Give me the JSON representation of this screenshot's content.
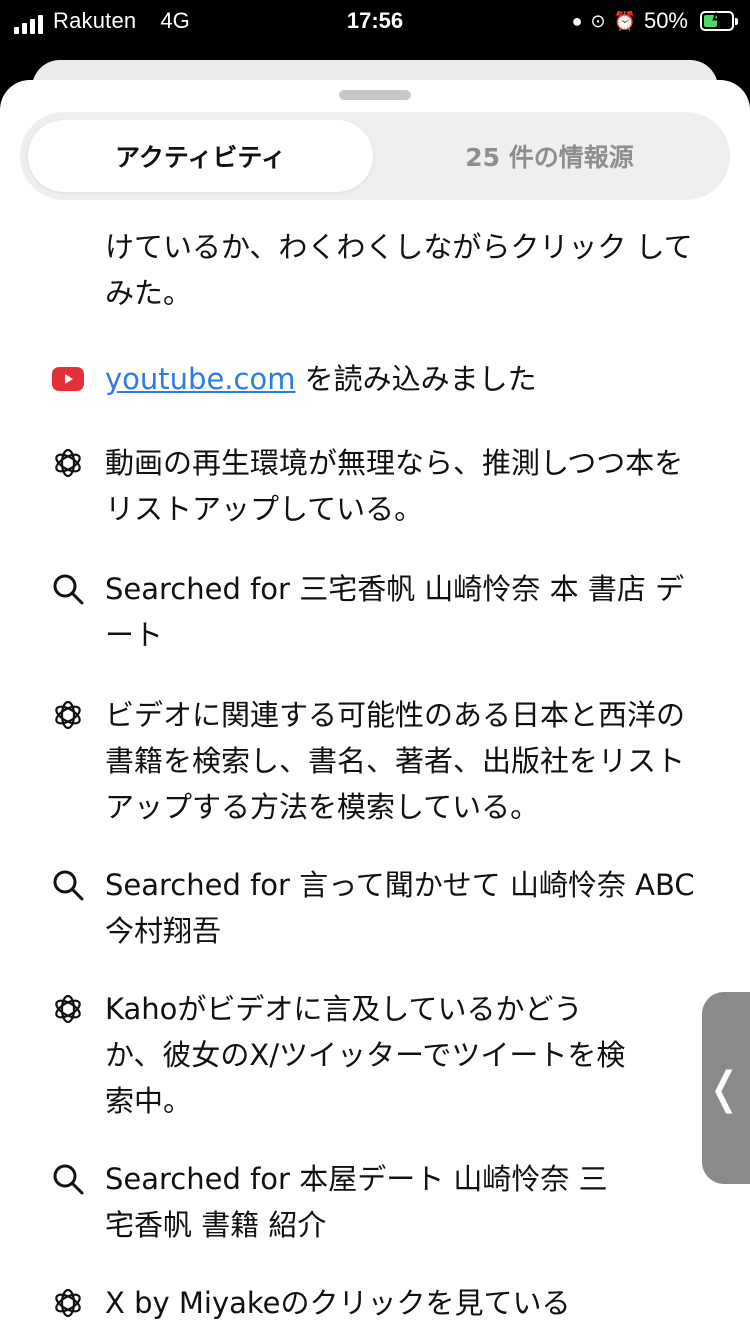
{
  "status": {
    "carrier": "Rakuten",
    "network": "4G",
    "time": "17:56",
    "battery": "50%",
    "battery_level": 0.5
  },
  "tabs": {
    "activity": "アクティビティ",
    "sources": "25 件の情報源"
  },
  "feed": [
    {
      "type": "text",
      "icon": "none",
      "text": "けているか、わくわくしながらクリック してみた。"
    },
    {
      "type": "load",
      "icon": "youtube-icon",
      "link": "youtube.com",
      "text": " を読み込みました"
    },
    {
      "type": "thought",
      "icon": "openai-icon",
      "text": "動画の再生環境が無理なら、推測しつつ本をリストアップしている。"
    },
    {
      "type": "search",
      "icon": "search-icon",
      "text": "Searched for 三宅香帆 山崎怜奈 本 書店 デート"
    },
    {
      "type": "thought",
      "icon": "openai-icon",
      "text": "ビデオに関連する可能性のある日本と西洋の書籍を検索し、書名、著者、出版社をリストアップする方法を模索している。"
    },
    {
      "type": "search",
      "icon": "search-icon",
      "text": "Searched for 言って聞かせて 山崎怜奈 ABC 今村翔吾"
    },
    {
      "type": "thought",
      "icon": "openai-icon",
      "text": "Kahoがビデオに言及しているかどうか、彼女のX/ツイッターでツイートを検索中。"
    },
    {
      "type": "search",
      "icon": "search-icon",
      "text": "Searched for 本屋デート 山崎怜奈 三宅香帆 書籍 紹介"
    },
    {
      "type": "thought",
      "icon": "openai-icon",
      "text": "X by Miyakeのクリックを見ている"
    }
  ],
  "side_handle": {
    "glyph": "❬"
  }
}
